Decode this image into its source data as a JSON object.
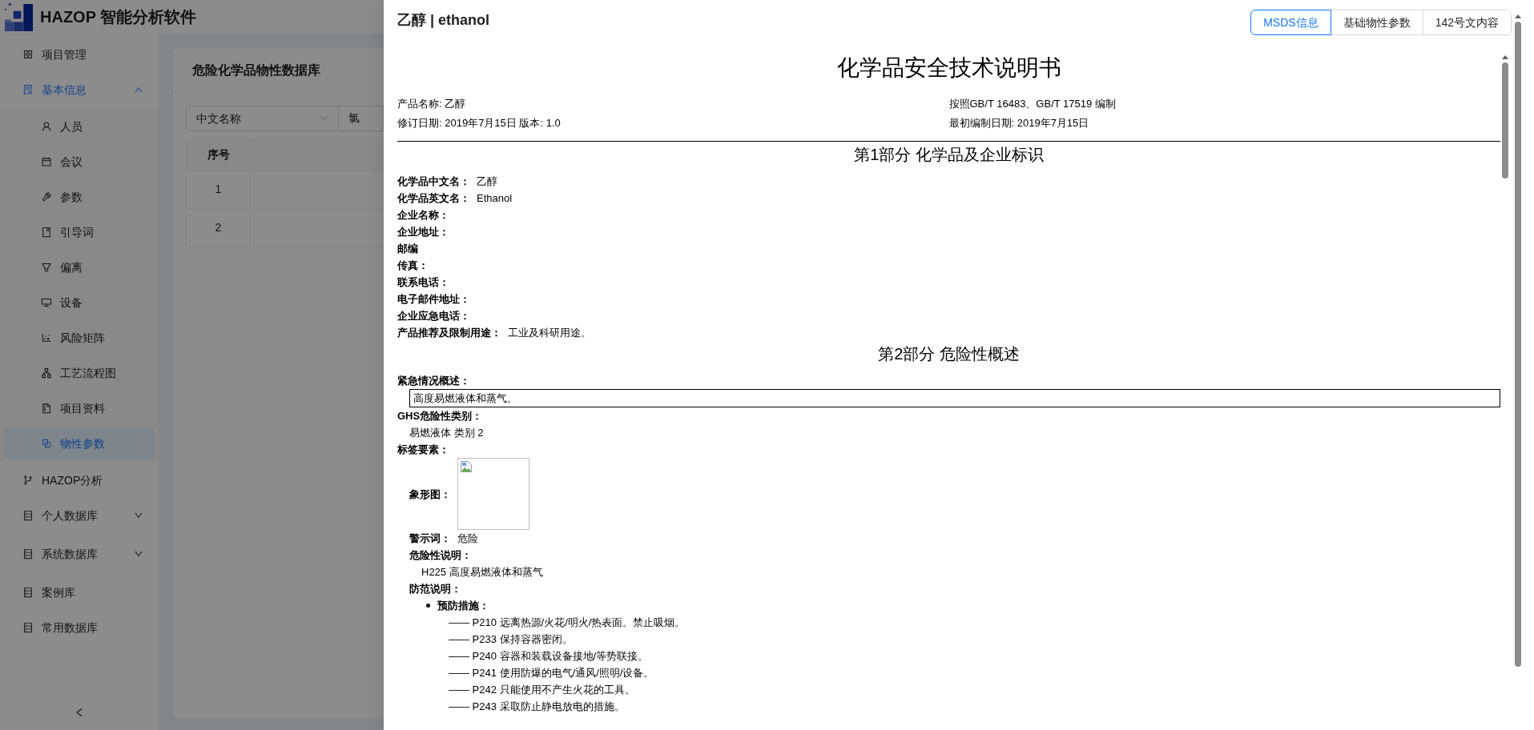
{
  "app": {
    "title": "HAZOP 智能分析软件"
  },
  "sidebar": {
    "items": [
      {
        "label": "项目管理",
        "selected": false
      },
      {
        "label": "基本信息",
        "selected": false,
        "expanded": true,
        "children": [
          {
            "label": "人员",
            "selected": false
          },
          {
            "label": "会议",
            "selected": false
          },
          {
            "label": "参数",
            "selected": false
          },
          {
            "label": "引导词",
            "selected": false
          },
          {
            "label": "偏离",
            "selected": false
          },
          {
            "label": "设备",
            "selected": false
          },
          {
            "label": "风险矩阵",
            "selected": false
          },
          {
            "label": "工艺流程图",
            "selected": false
          },
          {
            "label": "项目资料",
            "selected": false
          },
          {
            "label": "物性参数",
            "selected": true
          }
        ]
      },
      {
        "label": "HAZOP分析",
        "selected": false
      },
      {
        "label": "个人数据库",
        "selected": false,
        "expanded": false
      },
      {
        "label": "系统数据库",
        "selected": false,
        "expanded": false
      },
      {
        "label": "案例库",
        "selected": false
      },
      {
        "label": "常用数据库",
        "selected": false
      }
    ]
  },
  "page": {
    "title": "危险化学品物性数据库",
    "search": {
      "field": "中文名称",
      "value": "氯"
    },
    "table": {
      "columns": [
        "序号"
      ],
      "rows": [
        [
          "1"
        ],
        [
          "2"
        ]
      ]
    }
  },
  "drawer": {
    "title": "乙醇 | ethanol",
    "tabs": [
      {
        "label": "MSDS信息",
        "selected": true
      },
      {
        "label": "基础物性参数",
        "selected": false
      },
      {
        "label": "142号文内容",
        "selected": false
      }
    ],
    "document": {
      "title": "化学品安全技术说明书",
      "meta": [
        {
          "left": "产品名称: 乙醇",
          "right": "按照GB/T 16483、GB/T 17519 编制"
        },
        {
          "left": "修订日期: 2019年7月15日 版本: 1.0",
          "right": "最初编制日期: 2019年7月15日"
        }
      ],
      "sections": [
        {
          "heading": "第1部分 化学品及企业标识",
          "blocks": [
            {
              "kind": "field",
              "label": "化学品中文名：",
              "value": "乙醇"
            },
            {
              "kind": "field",
              "label": "化学品英文名：",
              "value": "Ethanol"
            },
            {
              "kind": "field",
              "label": "企业名称："
            },
            {
              "kind": "field",
              "label": "企业地址："
            },
            {
              "kind": "field",
              "label": "邮编"
            },
            {
              "kind": "field",
              "label": "传真："
            },
            {
              "kind": "field",
              "label": "联系电话："
            },
            {
              "kind": "field",
              "label": "电子邮件地址："
            },
            {
              "kind": "field",
              "label": "企业应急电话："
            },
            {
              "kind": "field",
              "label": "产品推荐及限制用途：",
              "value": "工业及科研用途。"
            }
          ]
        },
        {
          "heading": "第2部分 危险性概述",
          "blocks": [
            {
              "kind": "field",
              "label": "紧急情况概述：",
              "children": [
                {
                  "kind": "boxed",
                  "text": "高度易燃液体和蒸气。"
                }
              ]
            },
            {
              "kind": "field",
              "label": "GHS危险性类别：",
              "children": [
                {
                  "kind": "text",
                  "text": "易燃液体 类别 2"
                }
              ]
            },
            {
              "kind": "field",
              "label": "标签要素：",
              "children": [
                {
                  "kind": "pictogram",
                  "label": "象形图："
                },
                {
                  "kind": "field",
                  "label": "警示词：",
                  "value": "危险"
                },
                {
                  "kind": "field",
                  "label": "危险性说明：",
                  "children": [
                    {
                      "kind": "text",
                      "text": "H225 高度易燃液体和蒸气"
                    }
                  ]
                },
                {
                  "kind": "field",
                  "label": "防范说明：",
                  "children": [
                    {
                      "kind": "bullet",
                      "label": "预防措施：",
                      "children": [
                        {
                          "kind": "text",
                          "text": "—— P210 远离热源/火花/明火/热表面。禁止吸烟。"
                        },
                        {
                          "kind": "text",
                          "text": "—— P233 保持容器密闭。"
                        },
                        {
                          "kind": "text",
                          "text": "—— P240 容器和装载设备接地/等势联接。"
                        },
                        {
                          "kind": "text",
                          "text": "—— P241 使用防爆的电气/通风/照明/设备。"
                        },
                        {
                          "kind": "text",
                          "text": "—— P242 只能使用不产生火花的工具。"
                        },
                        {
                          "kind": "text",
                          "text": "—— P243 采取防止静电放电的措施。"
                        }
                      ]
                    }
                  ]
                }
              ]
            }
          ]
        }
      ]
    }
  }
}
